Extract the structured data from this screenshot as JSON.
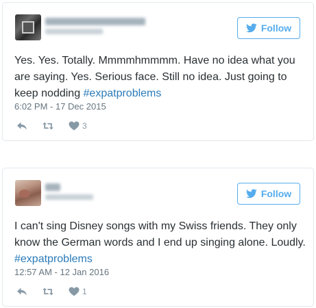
{
  "tweets": [
    {
      "follow_label": "Follow",
      "text": "Yes. Yes. Totally. Mmmmhmmmm. Have no idea what you are saying. Yes. Serious face. Still no idea. Just going to keep nodding ",
      "hashtag": "#expatproblems",
      "timestamp": "6:02 PM - 17 Dec 2015",
      "like_count": "3"
    },
    {
      "follow_label": "Follow",
      "text": "I can't sing Disney songs with my Swiss friends. They only know the German words and I end up singing alone. Loudly. ",
      "hashtag": "#expatproblems",
      "timestamp": "12:57 AM - 12 Jan 2016",
      "like_count": "1"
    }
  ],
  "icons": {
    "brand": "bird-icon",
    "reply": "reply-icon",
    "retweet": "retweet-icon",
    "like": "heart-icon"
  },
  "colors": {
    "accent": "#55acee",
    "hashtag": "#2b7bb9",
    "muted": "#8899a6",
    "text": "#292f33",
    "border": "#e1e8ed"
  }
}
